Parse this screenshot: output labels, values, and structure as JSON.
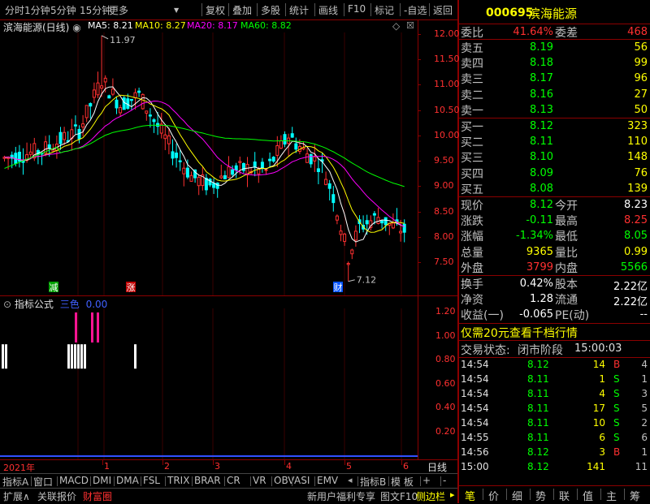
{
  "toolbar": {
    "left_tabs": [
      "分时",
      "1分钟",
      "5分钟",
      "15分钟",
      "更多"
    ],
    "right_tabs": [
      "复权",
      "叠加",
      "多股",
      "统计",
      "画线",
      "F10",
      "标记",
      "-自选",
      "返回"
    ]
  },
  "chart": {
    "title": "滨海能源(日线)",
    "ma5_label": "MA5: 8.21",
    "ma10_label": "MA10: 8.27",
    "ma20_label": "MA20: 8.17",
    "ma60_label": "MA60: 8.82",
    "high_annotation": "11.97",
    "low_annotation": "7.12",
    "y_ticks": [
      "12.00",
      "11.50",
      "11.00",
      "10.50",
      "10.00",
      "9.50",
      "9.00",
      "8.50",
      "8.00",
      "7.50"
    ],
    "markers": [
      {
        "text": "减",
        "color": "#00a000"
      },
      {
        "text": "涨",
        "color": "#c00000"
      },
      {
        "text": "财",
        "color": "#0050ff"
      }
    ],
    "colors": {
      "up": "#ff3030",
      "down": "#00ffff",
      "ma5": "#ffffff",
      "ma10": "#ffff00",
      "ma20": "#ff00ff",
      "ma60": "#00ff00"
    }
  },
  "indicator": {
    "title": "指标公式",
    "label_color": "三色",
    "value": "0.00",
    "y_ticks": [
      "1.20",
      "1.00",
      "0.80",
      "0.60",
      "0.40",
      "0.20"
    ]
  },
  "time_axis": {
    "year_label": "2021年",
    "months": [
      "1",
      "2",
      "3",
      "4",
      "5",
      "6"
    ],
    "period": "日线"
  },
  "indicator_tabs": [
    "指标A",
    "窗口",
    "MACD",
    "DMI",
    "DMA",
    "FSL",
    "TRIX",
    "BRAR",
    "CR",
    "VR",
    "OBV",
    "ASI",
    "EMV",
    "指标B",
    "模 板",
    "+",
    "-"
  ],
  "bottom_bar": {
    "left": [
      "扩展∧",
      "关联报价",
      "财富圈"
    ],
    "right": [
      "新用户福利专享",
      "图文F10",
      "侧边栏"
    ]
  },
  "quote": {
    "code": "000695",
    "name": "滨海能源",
    "weibi_label": "委比",
    "weibi": "41.64%",
    "weicha_label": "委差",
    "weicha": "468",
    "asks": [
      {
        "label": "卖五",
        "price": "8.19",
        "vol": "56"
      },
      {
        "label": "卖四",
        "price": "8.18",
        "vol": "99"
      },
      {
        "label": "卖三",
        "price": "8.17",
        "vol": "96"
      },
      {
        "label": "卖二",
        "price": "8.16",
        "vol": "27"
      },
      {
        "label": "卖一",
        "price": "8.13",
        "vol": "50"
      }
    ],
    "bids": [
      {
        "label": "买一",
        "price": "8.12",
        "vol": "323"
      },
      {
        "label": "买二",
        "price": "8.11",
        "vol": "110"
      },
      {
        "label": "买三",
        "price": "8.10",
        "vol": "148"
      },
      {
        "label": "买四",
        "price": "8.09",
        "vol": "76"
      },
      {
        "label": "买五",
        "price": "8.08",
        "vol": "139"
      }
    ],
    "stats": [
      {
        "l1": "现价",
        "v1": "8.12",
        "c1": "green",
        "l2": "今开",
        "v2": "8.23",
        "c2": "white"
      },
      {
        "l1": "涨跌",
        "v1": "-0.11",
        "c1": "green",
        "l2": "最高",
        "v2": "8.25",
        "c2": "red"
      },
      {
        "l1": "涨幅",
        "v1": "-1.34%",
        "c1": "green",
        "l2": "最低",
        "v2": "8.05",
        "c2": "green"
      },
      {
        "l1": "总量",
        "v1": "9365",
        "c1": "yellow",
        "l2": "量比",
        "v2": "0.99",
        "c2": "yellow"
      },
      {
        "l1": "外盘",
        "v1": "3799",
        "c1": "red",
        "l2": "内盘",
        "v2": "5566",
        "c2": "green"
      }
    ],
    "stats2": [
      {
        "l1": "换手",
        "v1": "0.42%",
        "l2": "股本",
        "v2": "2.22亿"
      },
      {
        "l1": "净资",
        "v1": "1.28",
        "l2": "流通",
        "v2": "2.22亿"
      },
      {
        "l1": "收益(一)",
        "v1": "-0.065",
        "l2": "PE(动)",
        "v2": "--"
      }
    ],
    "promo": "仅需20元查看千档行情",
    "trade_status_label": "交易状态:",
    "trade_status": "闭市阶段",
    "trade_time": "15:00:03",
    "ticks": [
      {
        "t": "14:54",
        "p": "8.12",
        "v": "14",
        "bs": "B",
        "n": "4"
      },
      {
        "t": "14:54",
        "p": "8.11",
        "v": "1",
        "bs": "S",
        "n": "1"
      },
      {
        "t": "14:54",
        "p": "8.11",
        "v": "4",
        "bs": "S",
        "n": "3"
      },
      {
        "t": "14:54",
        "p": "8.11",
        "v": "17",
        "bs": "S",
        "n": "5"
      },
      {
        "t": "14:54",
        "p": "8.11",
        "v": "10",
        "bs": "S",
        "n": "2"
      },
      {
        "t": "14:55",
        "p": "8.11",
        "v": "6",
        "bs": "S",
        "n": "6"
      },
      {
        "t": "14:56",
        "p": "8.12",
        "v": "3",
        "bs": "B",
        "n": "1"
      },
      {
        "t": "15:00",
        "p": "8.12",
        "v": "141",
        "bs": "",
        "n": "11"
      }
    ],
    "bottom_tabs": [
      "笔",
      "价",
      "细",
      "势",
      "联",
      "值",
      "主",
      "筹"
    ]
  }
}
